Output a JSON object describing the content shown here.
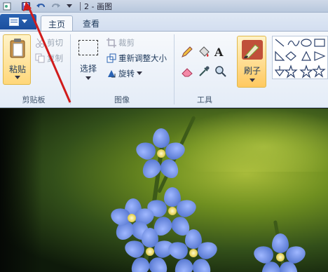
{
  "window": {
    "title": "2 - 画图"
  },
  "tabs": [
    {
      "label": "主页"
    },
    {
      "label": "查看"
    }
  ],
  "clipboard": {
    "paste": "粘贴",
    "cut": "剪切",
    "copy": "复制",
    "group": "剪贴板"
  },
  "image": {
    "select": "选择",
    "crop": "裁剪",
    "resize": "重新调整大小",
    "rotate": "旋转",
    "group": "图像"
  },
  "tools": {
    "group": "工具",
    "text_glyph": "A"
  },
  "brushes": {
    "label": "刷子"
  },
  "colors": {
    "accent": "#1b4f9e",
    "arrow": "#d11c1c",
    "petal": "#5f7fd6"
  }
}
